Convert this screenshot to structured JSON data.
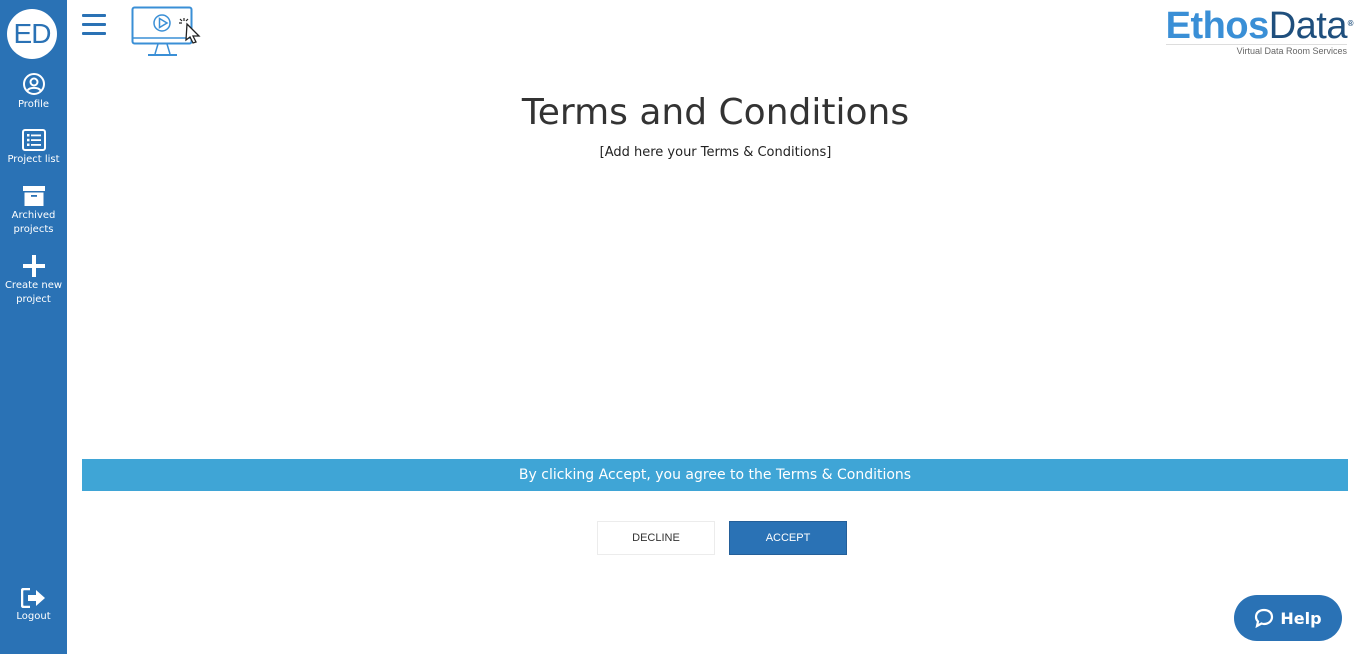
{
  "sidebar": {
    "logo_text": "ED",
    "items": [
      {
        "label": "Profile",
        "icon": "user-circle-icon"
      },
      {
        "label": "Project list",
        "icon": "list-icon"
      },
      {
        "label": "Archived projects",
        "icon": "archive-box-icon"
      },
      {
        "label": "Create new project",
        "icon": "plus-icon"
      }
    ],
    "logout": {
      "label": "Logout",
      "icon": "logout-icon"
    }
  },
  "header": {
    "menu_icon": "hamburger-icon",
    "tutorial_icon": "video-tutorial-icon",
    "brand": {
      "part1": "Ethos",
      "part2": "Data",
      "registered": "®",
      "tagline": "Virtual Data Room Services"
    }
  },
  "main": {
    "title": "Terms and Conditions",
    "subtitle": "[Add here your Terms & Conditions]",
    "notice": "By clicking Accept, you agree to the Terms & Conditions",
    "decline_label": "DECLINE",
    "accept_label": "ACCEPT"
  },
  "help": {
    "label": "Help",
    "icon": "chat-bubble-icon"
  },
  "colors": {
    "sidebar": "#2a72b5",
    "notice_bar": "#3fa5d6",
    "accent": "#2a72b5"
  }
}
